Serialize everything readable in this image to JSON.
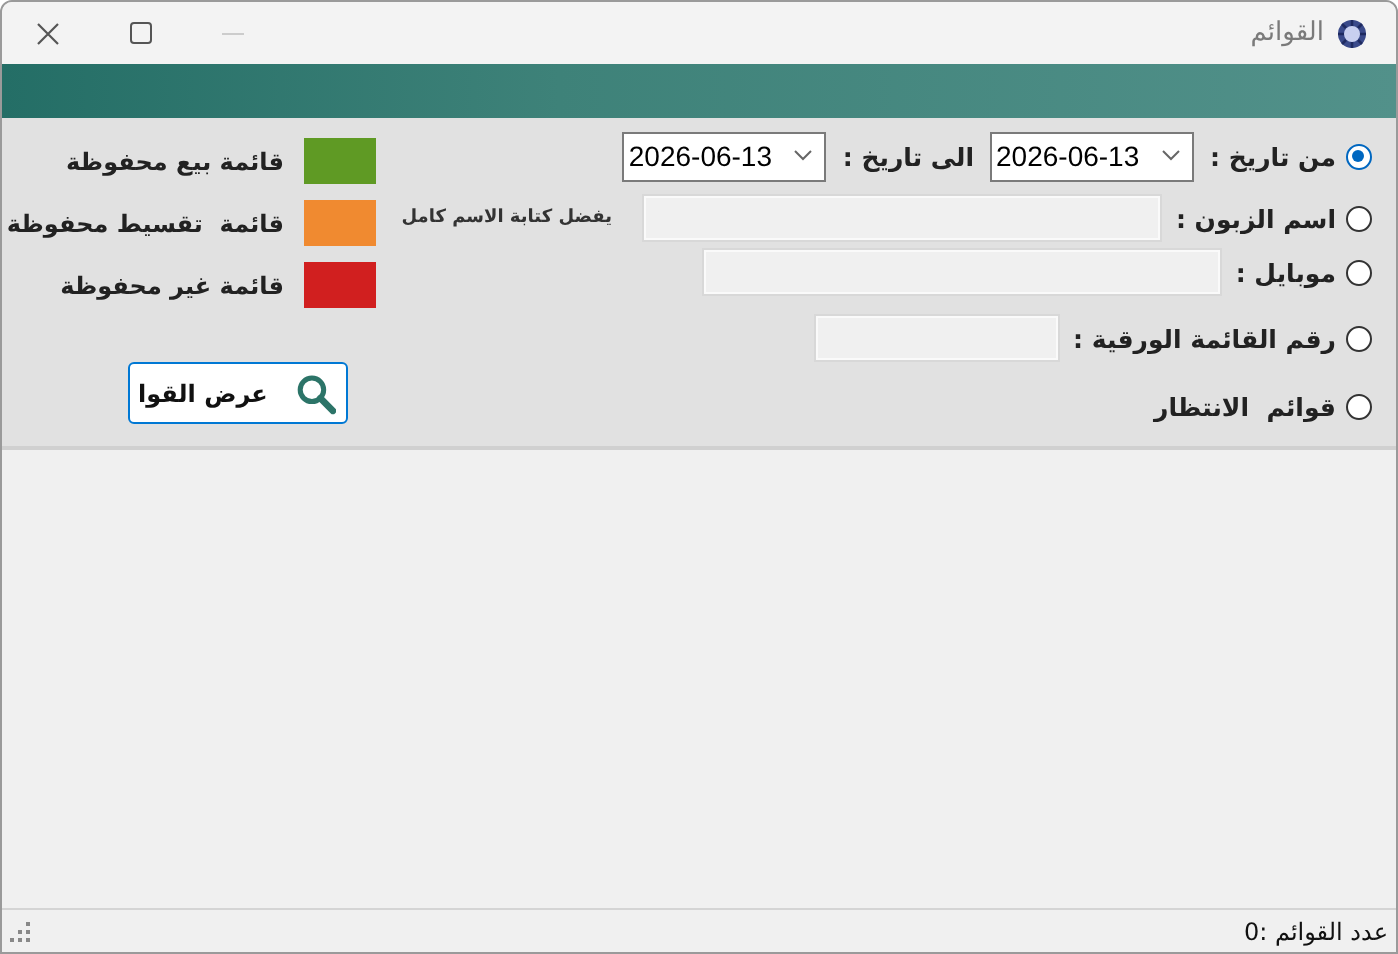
{
  "window": {
    "title": "القوائم"
  },
  "filters": [
    {
      "kind": "date_range",
      "label": "من تاريخ :",
      "selected": true,
      "from": "2026-06-13",
      "to_label": "الى تاريخ :",
      "to": "2026-06-13"
    },
    {
      "kind": "text",
      "label": "اسم الزبون :",
      "selected": false,
      "hint": "يفضل كتابة الاسم كامل"
    },
    {
      "kind": "text",
      "label": "موبايل :",
      "selected": false
    },
    {
      "kind": "text",
      "label": "رقم القائمة الورقية :",
      "selected": false
    },
    {
      "kind": "option",
      "label": "قوائم  الانتظار",
      "selected": false
    }
  ],
  "legend": [
    {
      "label": "قائمة بيع محفوظة",
      "color": "#5f9a24"
    },
    {
      "label": "قائمة  تقسيط محفوظة",
      "color": "#f08a30"
    },
    {
      "label": "قائمة غير محفوظة",
      "color": "#d11f1f"
    }
  ],
  "show_button": {
    "label": "عرض القوا"
  },
  "status_bar": {
    "text": "عدد القوائم :0"
  }
}
